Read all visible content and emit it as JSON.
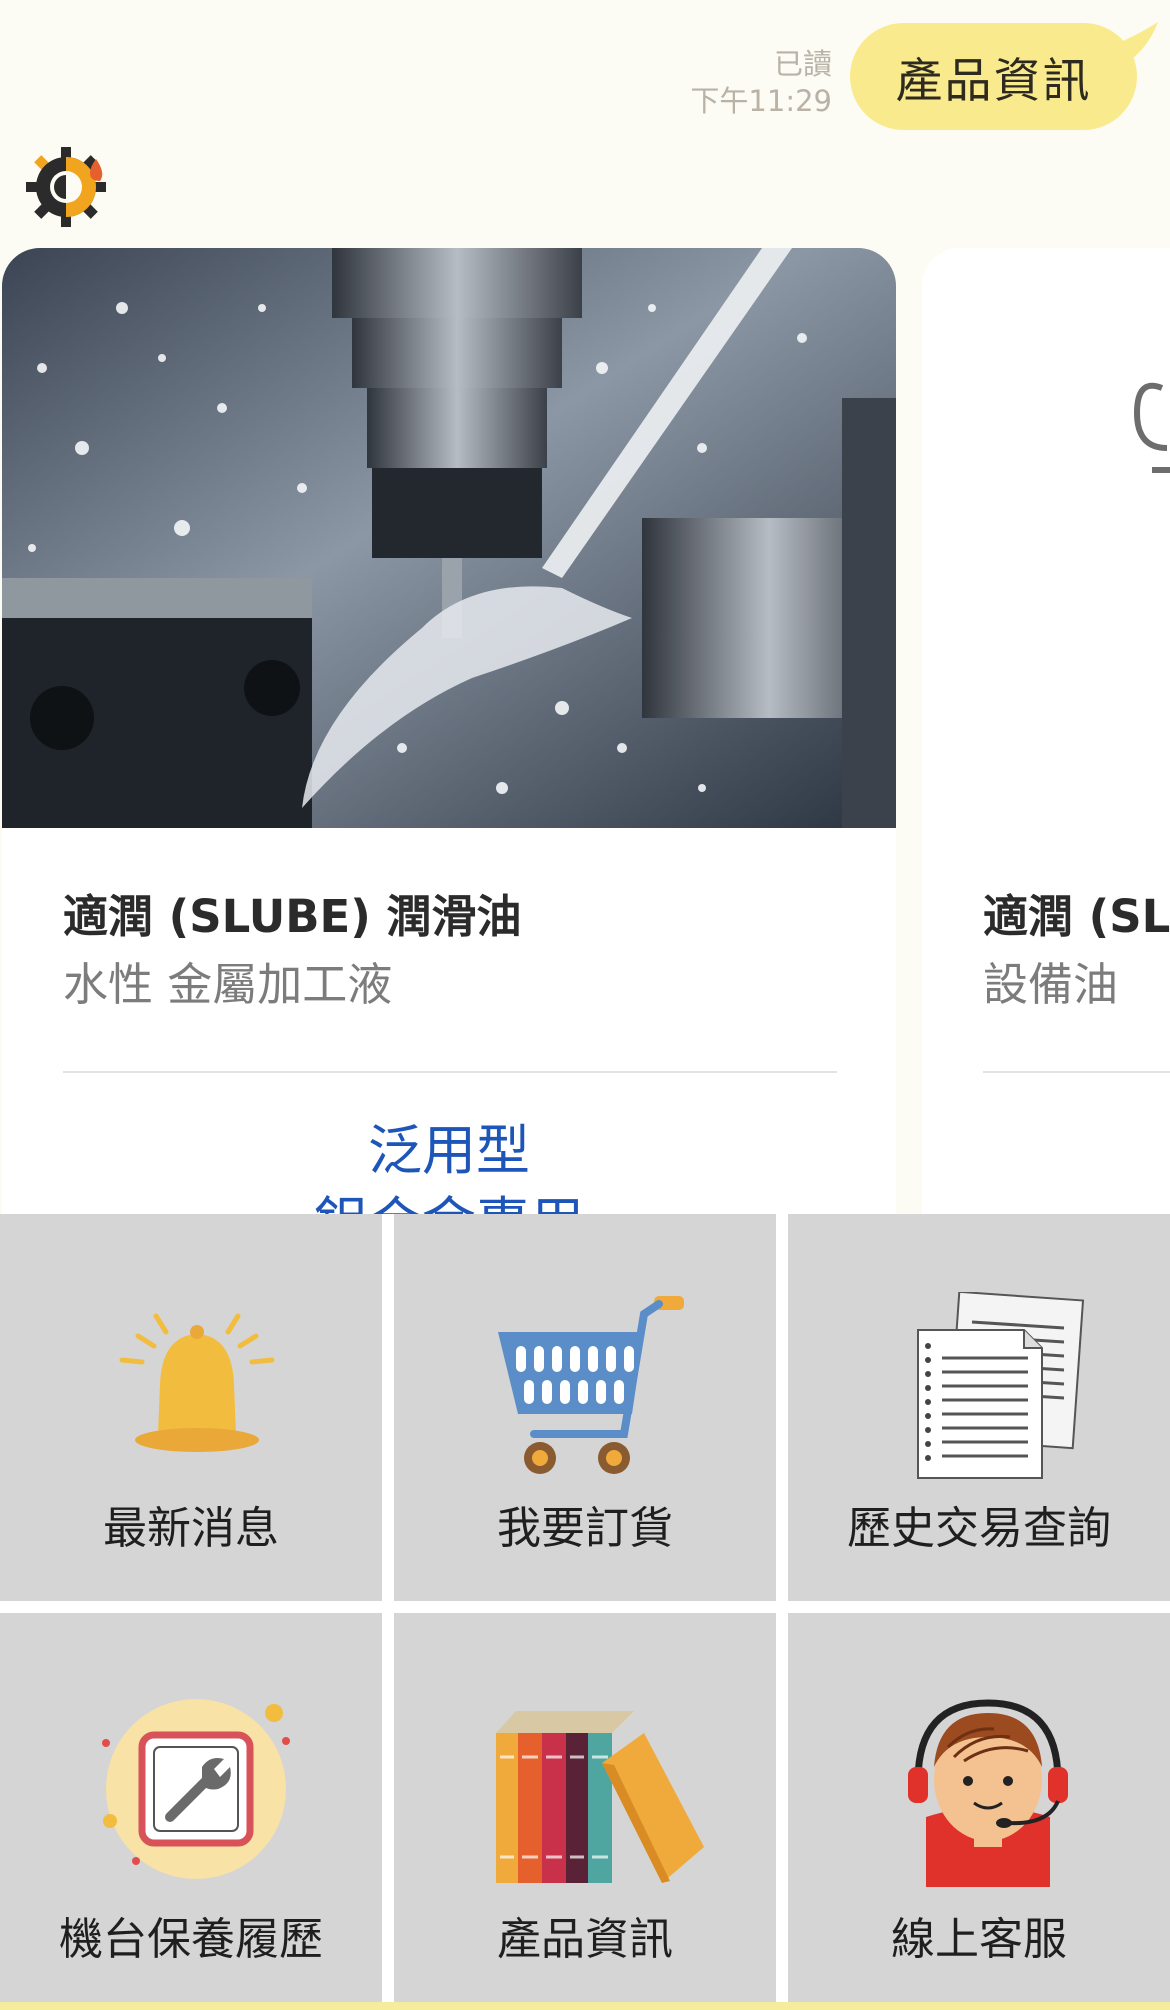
{
  "chat": {
    "read_status": "已讀",
    "sent_time": "下午11:29",
    "user_message": "產品資訊"
  },
  "cards": [
    {
      "title": "適潤 (SLUBE) 潤滑油",
      "subtitle": "水性 金屬加工液",
      "actions": [
        "泛用型",
        "鋁合金專用"
      ]
    },
    {
      "title": "適潤 (SLU",
      "subtitle": "設備油"
    }
  ],
  "menu": {
    "items": [
      {
        "label": "最新消息",
        "icon": "bell-icon"
      },
      {
        "label": "我要訂貨",
        "icon": "shopping-cart-icon"
      },
      {
        "label": "歷史交易查詢",
        "icon": "documents-icon"
      },
      {
        "label": "機台保養履歷",
        "icon": "wrench-icon"
      },
      {
        "label": "產品資訊",
        "icon": "books-icon"
      },
      {
        "label": "線上客服",
        "icon": "customer-service-icon"
      }
    ]
  },
  "colors": {
    "chat_background": "#fdfcf4",
    "user_bubble": "#faea8e",
    "action_link": "#1d55b8",
    "menu_tile": "#d5d5d5"
  }
}
